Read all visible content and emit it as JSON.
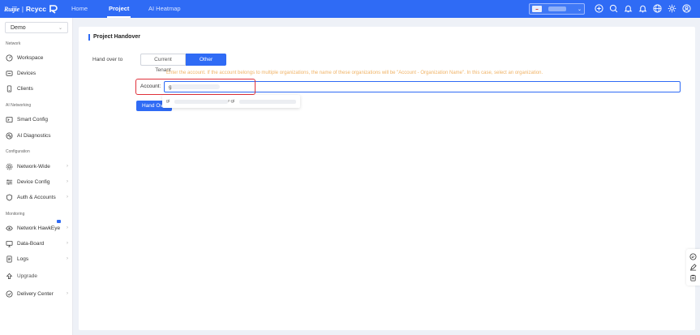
{
  "app": {
    "brand": "Ruijie",
    "separator": "|",
    "name": "Rcycc"
  },
  "nav": {
    "home": "Home",
    "project": "Project",
    "ai_heatmap": "AI Heatmap"
  },
  "org_select": {
    "caret": "⌄"
  },
  "sidebar": {
    "tenant": "Demo",
    "tenant_caret": "⌄",
    "sections": {
      "network": "Network",
      "ai_networking": "AI Networking",
      "configuration": "Configuration",
      "monitoring": "Monitoring"
    },
    "items": {
      "workspace": "Workspace",
      "devices": "Devices",
      "clients": "Clients",
      "smart_config": "Smart Config",
      "ai_diagnostics": "AI Diagnostics",
      "network_wide": "Network-Wide",
      "device_config": "Device Config",
      "auth_accounts": "Auth & Accounts",
      "network_hawkeye": "Network HawkEye",
      "data_board": "Data-Board",
      "logs": "Logs",
      "upgrade": "Upgrade",
      "delivery_center": "Delivery Center"
    },
    "chevron": "›"
  },
  "panel": {
    "title": "Project Handover",
    "hand_over_to_label": "Hand over to",
    "current_tenant": "Current Tenant",
    "other_tenant": "Other Tenant",
    "hint": "Enter the account. If the account belongs to multiple organizations, the name of these organizations will be \"Account - Organization Name\". In this case, select an organization.",
    "account_label": "Account:",
    "account_value": "g",
    "dropdown_prefix": "gi",
    "dropdown_mid": "r-gi",
    "handover_button": "Hand Over"
  },
  "colors": {
    "primary": "#2f6bf5",
    "highlight": "#e0313b",
    "hint": "#f0b366"
  }
}
